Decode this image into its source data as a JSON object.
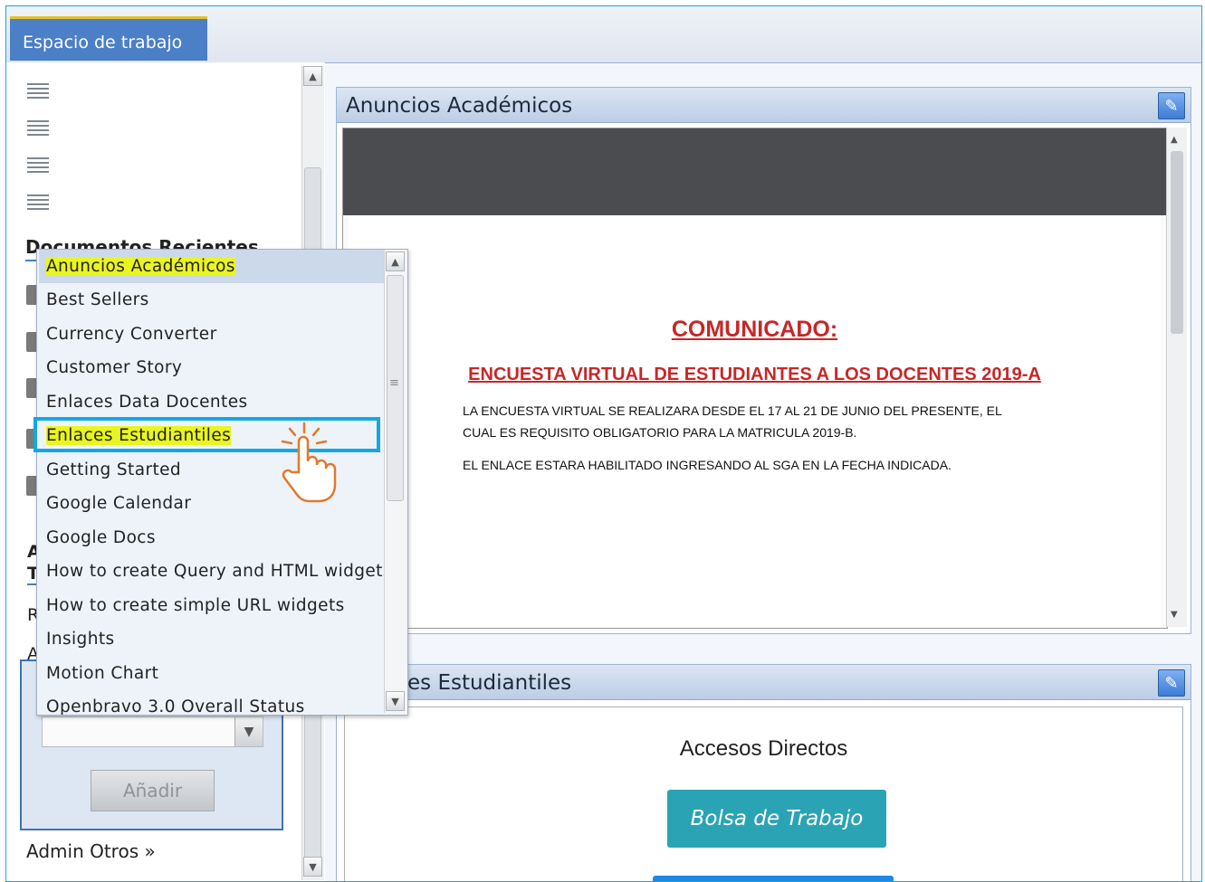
{
  "tab": {
    "label": "Espacio de trabajo"
  },
  "sidebar": {
    "docs_title": "Documentos Recientes",
    "partial_labels": [
      "A",
      "T",
      "R",
      "A"
    ],
    "add_button": "Añadir",
    "admin_link": "Admin Otros »"
  },
  "dropdown": {
    "items": [
      "Anuncios Académicos",
      "Best Sellers",
      "Currency Converter",
      "Customer Story",
      "Enlaces Data Docentes",
      "Enlaces Estudiantiles",
      "Getting Started",
      "Google Calendar",
      "Google Docs",
      "How to create Query and HTML widgets",
      "How to create simple URL widgets",
      "Insights",
      "Motion Chart",
      "Openbravo 3.0 Overall Status"
    ],
    "highlighted": [
      "Anuncios Académicos",
      "Enlaces Estudiantiles"
    ],
    "pointed_item": "Enlaces Estudiantiles"
  },
  "widgets": {
    "announcements": {
      "title": "Anuncios Académicos",
      "heading": "COMUNICADO:",
      "subheading": "ENCUESTA VIRTUAL DE ESTUDIANTES A LOS DOCENTES 2019-A",
      "line1": "LA ENCUESTA VIRTUAL  SE REALIZARA DESDE EL 17 AL 21 DE JUNIO DEL PRESENTE, EL",
      "line2": "CUAL ES  REQUISITO OBLIGATORIO PARA LA MATRICULA  2019-B.",
      "line3": "EL ENLACE ESTARA HABILITADO INGRESANDO AL SGA EN LA FECHA INDICADA."
    },
    "links": {
      "title": "Enlaces Estudiantiles",
      "visible_title": "es Estudiantiles",
      "section": "Accesos Directos",
      "button": "Bolsa de Trabajo"
    }
  },
  "colors": {
    "accent": "#4b7fc8",
    "highlight": "#e9f520",
    "callout": "#14a7e3",
    "alert": "#c62828",
    "button": "#2aa4b4"
  }
}
